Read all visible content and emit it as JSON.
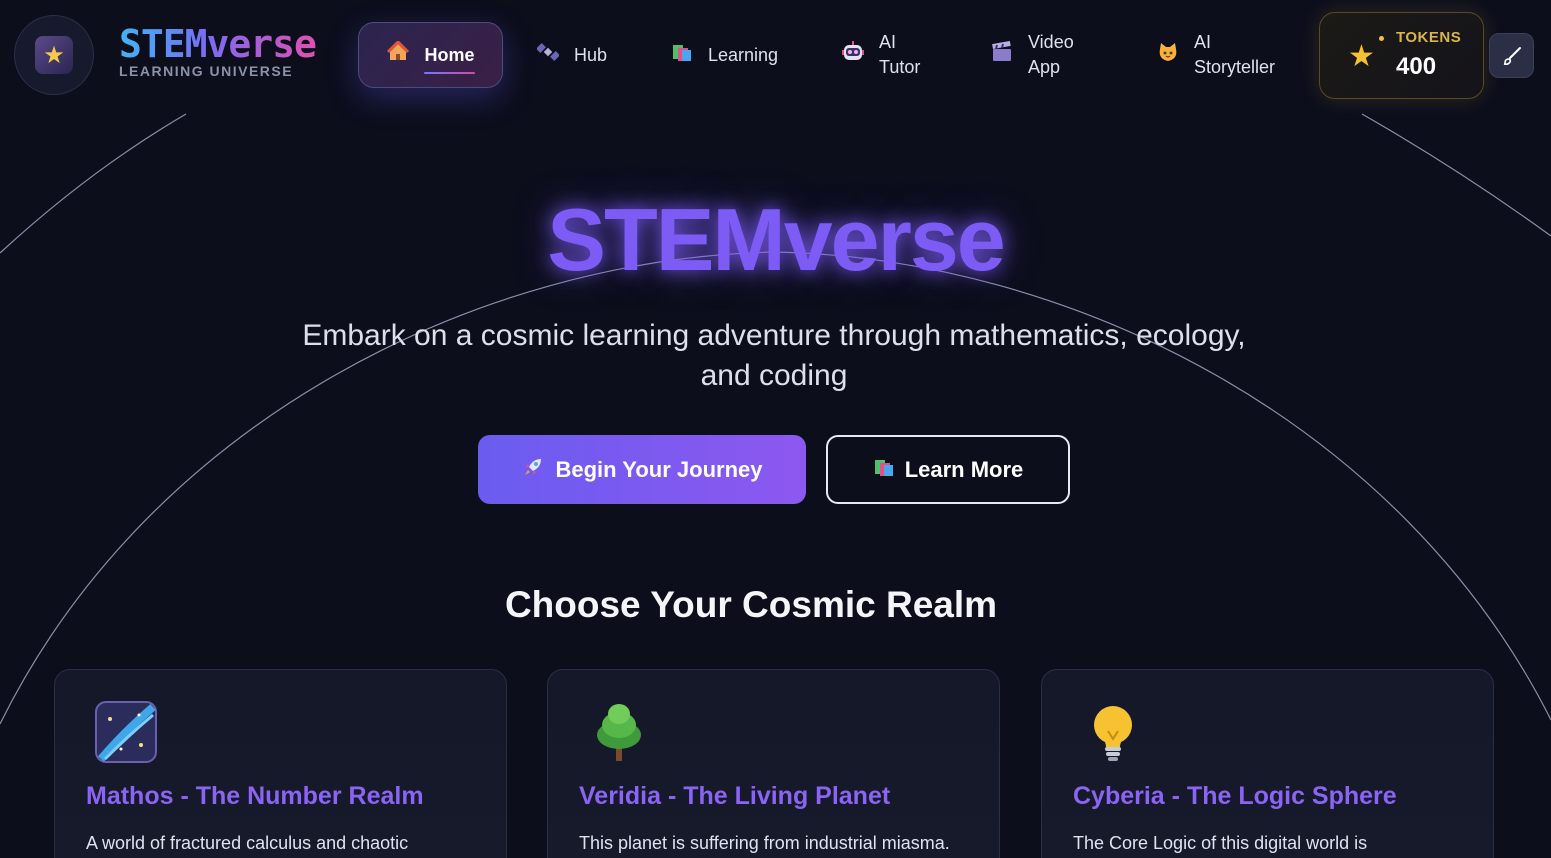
{
  "brand": {
    "title": "STEMverse",
    "subtitle": "LEARNING UNIVERSE"
  },
  "nav": {
    "items": [
      {
        "label": "Home",
        "icon": "house-icon",
        "active": true
      },
      {
        "label": "Hub",
        "icon": "satellite-icon"
      },
      {
        "label": "Learning",
        "icon": "books-icon"
      },
      {
        "label_line1": "AI",
        "label_line2": "Tutor",
        "icon": "robot-icon"
      },
      {
        "label_line1": "Video",
        "label_line2": "App",
        "icon": "clapperboard-icon"
      },
      {
        "label_line1": "AI",
        "label_line2": "Storyteller",
        "icon": "cat-icon"
      }
    ]
  },
  "tokens": {
    "label": "TOKENS",
    "value": "400"
  },
  "hero": {
    "title": "STEMverse",
    "subtitle": "Embark on a cosmic learning adventure through mathematics, ecology, and coding",
    "primary_button": "Begin Your Journey",
    "secondary_button": "Learn More"
  },
  "realms": {
    "heading": "Choose Your Cosmic Realm",
    "cards": [
      {
        "title": "Mathos - The Number Realm",
        "description": "A world of fractured calculus and chaotic",
        "icon": "galaxy-icon"
      },
      {
        "title": "Veridia - The Living Planet",
        "description": "This planet is suffering from industrial miasma.",
        "icon": "tree-icon"
      },
      {
        "title": "Cyberia - The Logic Sphere",
        "description": "The Core Logic of this digital world is",
        "icon": "lightbulb-icon"
      }
    ]
  },
  "colors": {
    "background": "#0c0e1c",
    "accent_purple": "#7c5cf5",
    "card_title": "#8a64f2",
    "token_gold": "#f6c232"
  }
}
